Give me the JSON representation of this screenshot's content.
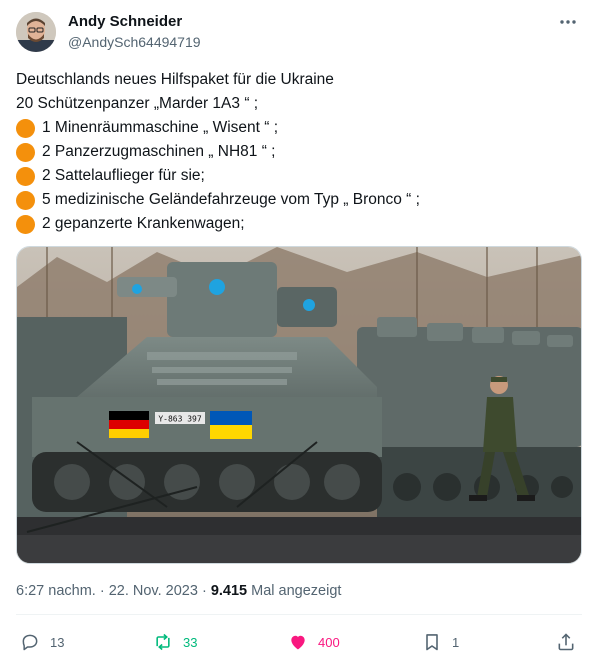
{
  "author": {
    "name": "Andy Schneider",
    "handle": "@AndySch64494719"
  },
  "tweet": {
    "line1": "Deutschlands neues Hilfspaket für die Ukraine",
    "line2": "20 Schützenpanzer „Marder 1A3 “ ;",
    "items": [
      "1 Minenräummaschine „ Wisent “ ;",
      "2 Panzerzugmaschinen „ NH81 “ ;",
      "2 Sattelauflieger für sie;",
      "5 medizinische Geländefahrzeuge vom Typ „ Bronco “ ;",
      "2 gepanzerte Krankenwagen;"
    ],
    "bullet_color": "#f4900c"
  },
  "media": {
    "plate_text": "Y-863 397"
  },
  "meta": {
    "time": "6:27 nachm.",
    "separator1": " · ",
    "date": "22. Nov. 2023",
    "separator2": " · ",
    "views_count": "9.415",
    "views_label": " Mal angezeigt"
  },
  "actions": {
    "replies": "13",
    "retweets": "33",
    "likes": "400",
    "bookmarks": "1"
  },
  "icons": {
    "more": "more-horizontal-icon",
    "reply": "reply-icon",
    "retweet": "retweet-icon",
    "like": "heart-icon",
    "bookmark": "bookmark-icon",
    "share": "share-icon"
  },
  "colors": {
    "text": "#0f1419",
    "secondary": "#536471",
    "retweet": "#00ba7c",
    "like": "#f91880"
  }
}
